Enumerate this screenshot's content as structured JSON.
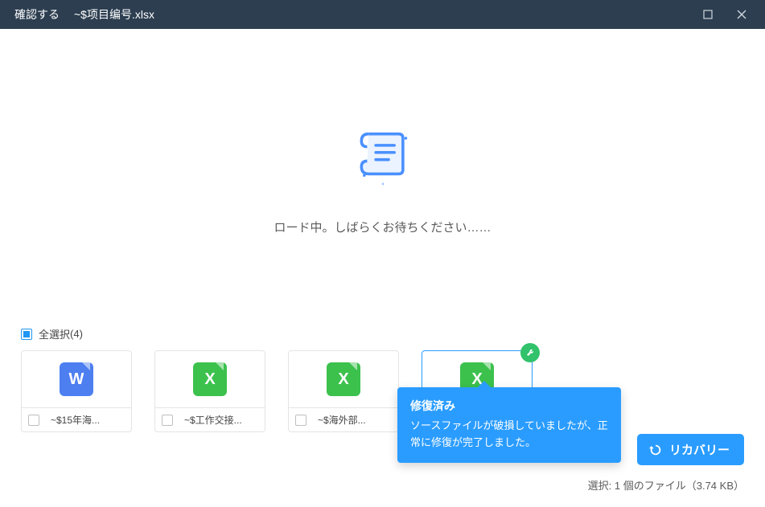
{
  "window": {
    "title": "確認する",
    "filename": "~$项目编号.xlsx"
  },
  "loading_text": "ロード中。しばらくお待ちください……",
  "select_all": {
    "label": "全選択",
    "count": "(4)"
  },
  "files": [
    {
      "type": "word",
      "letter": "W",
      "name": "~$15年海..."
    },
    {
      "type": "excel",
      "letter": "X",
      "name": "~$工作交接..."
    },
    {
      "type": "excel",
      "letter": "X",
      "name": "~$海外部..."
    },
    {
      "type": "excel",
      "letter": "X",
      "name": ""
    }
  ],
  "popover": {
    "title": "修復済み",
    "body": "ソースファイルが破損していましたが、正常に修復が完了しました。"
  },
  "recover_label": "リカバリー",
  "status_line": "選択: 1 個のファイル（3.74 KB）"
}
